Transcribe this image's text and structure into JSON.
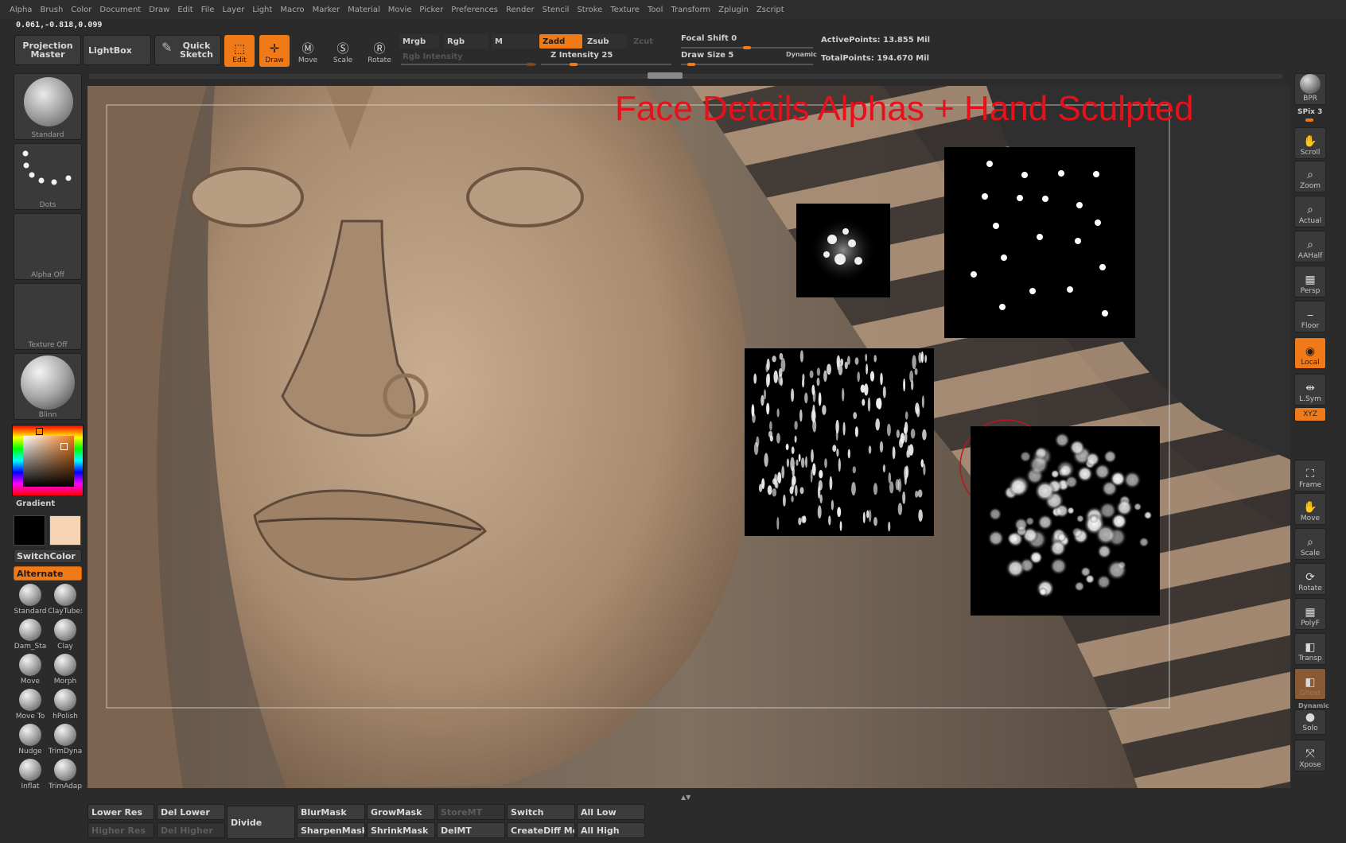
{
  "menu": [
    "Alpha",
    "Brush",
    "Color",
    "Document",
    "Draw",
    "Edit",
    "File",
    "Layer",
    "Light",
    "Macro",
    "Marker",
    "Material",
    "Movie",
    "Picker",
    "Preferences",
    "Render",
    "Stencil",
    "Stroke",
    "Texture",
    "Tool",
    "Transform",
    "Zplugin",
    "Zscript"
  ],
  "coords": "0.061,-0.818,0.099",
  "toolbar": {
    "projection_master": "Projection Master",
    "lightbox": "LightBox",
    "quick_sketch": "Quick Sketch",
    "edit": "Edit",
    "draw": "Draw",
    "move": "Move",
    "scale": "Scale",
    "rotate": "Rotate",
    "mrgb": "Mrgb",
    "rgb": "Rgb",
    "m": "M",
    "rgb_intensity": "Rgb Intensity",
    "zadd": "Zadd",
    "zsub": "Zsub",
    "zcut": "Zcut",
    "z_intensity": "Z Intensity 25",
    "focal_shift": "Focal Shift 0",
    "draw_size": "Draw Size 5",
    "dynamic": "Dynamic",
    "active_points": "ActivePoints: 13.855  Mil",
    "total_points": "TotalPoints: 194.670  Mil",
    "z_intensity_value": 25,
    "z_intensity_max": 100,
    "focal_shift_value": 0,
    "draw_size_value": 5
  },
  "left": {
    "standard": "Standard",
    "dots": "Dots",
    "alpha_off": "Alpha  Off",
    "texture_off": "Texture  Off",
    "blinn": "Blinn",
    "gradient": "Gradient",
    "switchcolor": "SwitchColor",
    "alternate": "Alternate",
    "brushes": [
      "Standard",
      "ClayTube:",
      "Dam_Sta",
      "Clay",
      "Move",
      "Morph",
      "Move  To",
      "hPolish",
      "Nudge",
      "TrimDyna",
      "Inflat",
      "TrimAdap"
    ]
  },
  "viewport": {
    "headline": "Face Details Alphas + Hand Sculpted"
  },
  "right": {
    "bpr": "BPR",
    "spix": "SPix 3",
    "tools": [
      "Scroll",
      "Zoom",
      "Actual",
      "AAHalf",
      "Persp",
      "Floor",
      "Local",
      "L.Sym",
      "XYZ",
      "Frame",
      "Move",
      "Scale",
      "Rotate",
      "PolyF",
      "Transp",
      "Ghost",
      "Dynamic",
      "Solo",
      "Xpose"
    ]
  },
  "bottom": {
    "lower_res": "Lower Res",
    "higher_res": "Higher Res",
    "del_lower": "Del Lower",
    "del_higher": "Del Higher",
    "divide": "Divide",
    "blurmask": "BlurMask",
    "sharpenmask": "SharpenMask",
    "growmask": "GrowMask",
    "shrinkmask": "ShrinkMask",
    "storemt": "StoreMT",
    "delmt": "DelMT",
    "switch": "Switch",
    "creatediff": "CreateDiff Me",
    "all_low": "All Low",
    "all_high": "All High"
  },
  "colors": {
    "accent": "#f07a18",
    "clay": "#b79a7e",
    "headline": "#e8101a",
    "secondary_swatch": "#f5d3b3"
  }
}
